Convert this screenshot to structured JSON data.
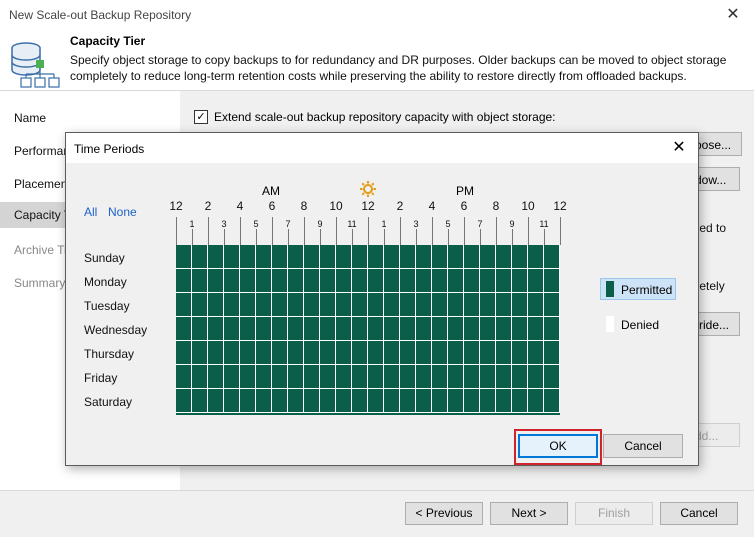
{
  "window": {
    "title": "New Scale-out Backup Repository"
  },
  "header": {
    "title": "Capacity Tier",
    "description": "Specify object storage to copy backups to for redundancy and DR purposes. Older backups can be moved to object storage completely to reduce long-term retention costs while preserving the ability to restore directly from offloaded backups."
  },
  "nav": {
    "items": [
      {
        "label": "Name",
        "disabled": false
      },
      {
        "label": "Performar",
        "disabled": false
      },
      {
        "label": "Placemen",
        "disabled": false
      },
      {
        "label": "Capacity T",
        "disabled": false,
        "selected": true
      },
      {
        "label": "Archive Ti",
        "disabled": true
      },
      {
        "label": "Summary",
        "disabled": true
      }
    ]
  },
  "content": {
    "extend_label": "Extend scale-out backup repository capacity with object storage:",
    "extend_checked": "✓",
    "choose_btn": "oose...",
    "window_btn": "dow...",
    "text_copied": "pied to",
    "text_completely": "pletely",
    "override_btn": "rride...",
    "add_btn": "dd..."
  },
  "footer": {
    "previous": "< Previous",
    "next": "Next >",
    "finish": "Finish",
    "cancel": "Cancel"
  },
  "dialog": {
    "title": "Time Periods",
    "close": "✕",
    "all_link": "All",
    "none_link": "None",
    "am_label": "AM",
    "pm_label": "PM",
    "hour_labels": [
      "12",
      "2",
      "4",
      "6",
      "8",
      "10",
      "12",
      "2",
      "4",
      "6",
      "8",
      "10",
      "12"
    ],
    "hour_sub_labels": [
      "1",
      "3",
      "5",
      "7",
      "9",
      "11",
      "1",
      "3",
      "5",
      "7",
      "9",
      "11"
    ],
    "days": [
      "Sunday",
      "Monday",
      "Tuesday",
      "Wednesday",
      "Thursday",
      "Friday",
      "Saturday"
    ],
    "legend": {
      "permitted": "Permitted",
      "denied": "Denied"
    },
    "ok": "OK",
    "cancel": "Cancel",
    "permitted_color": "#0b5e4a",
    "denied_color": "#ffffff",
    "permitted_hours_per_day": 24
  }
}
